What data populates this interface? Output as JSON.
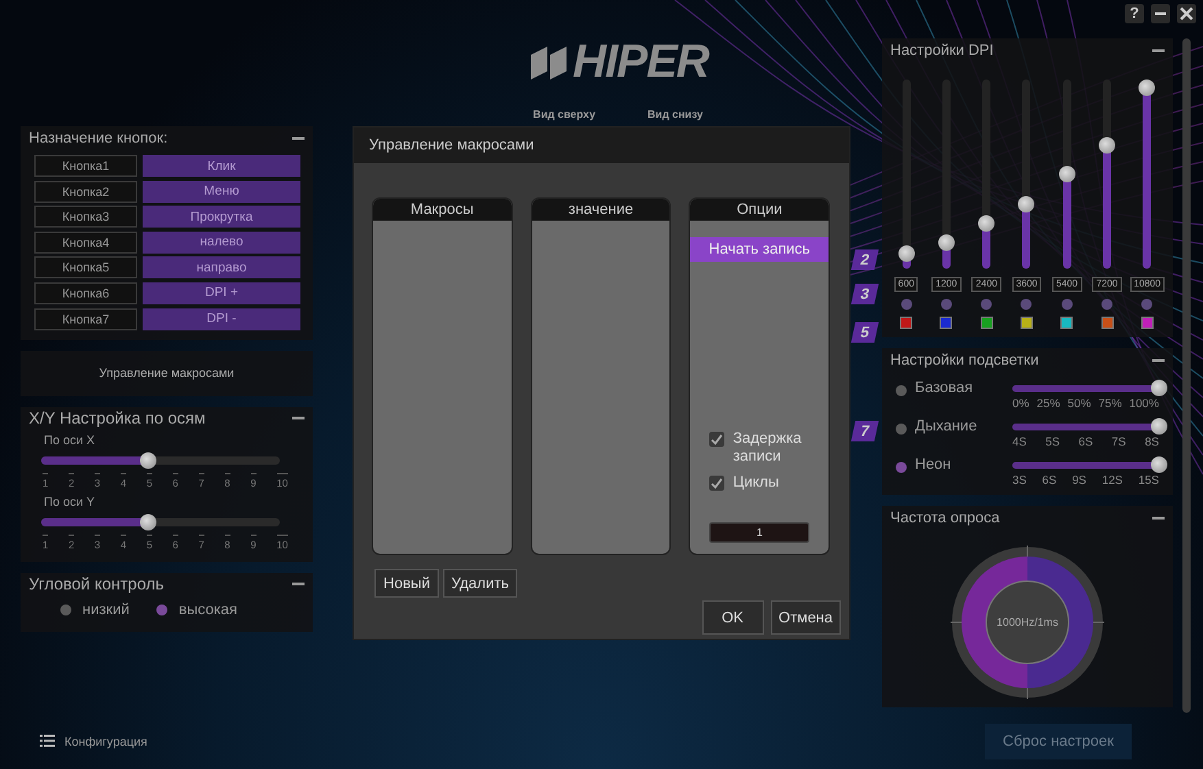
{
  "window_controls": {
    "help": "?"
  },
  "logo": {
    "text": "HIPER"
  },
  "views": [
    {
      "label": "Вид сверху"
    },
    {
      "label": "Вид снизу"
    }
  ],
  "button_assignment": {
    "title": "Назначение кнопок:",
    "rows": [
      {
        "button": "Кнопка1",
        "action": "Клик"
      },
      {
        "button": "Кнопка2",
        "action": "Меню"
      },
      {
        "button": "Кнопка3",
        "action": "Прокрутка"
      },
      {
        "button": "Кнопка4",
        "action": "налево"
      },
      {
        "button": "Кнопка5",
        "action": "направо"
      },
      {
        "button": "Кнопка6",
        "action": "DPI +"
      },
      {
        "button": "Кнопка7",
        "action": "DPI -"
      }
    ]
  },
  "macro_panel": {
    "label": "Управление макросами"
  },
  "axis": {
    "title": "X/Y Настройка по осям",
    "sliders": [
      {
        "label": "По оси X",
        "level": 0.45,
        "ticks": [
          "1",
          "2",
          "3",
          "4",
          "5",
          "6",
          "7",
          "8",
          "9",
          "10"
        ]
      },
      {
        "label": "По оси Y",
        "level": 0.45,
        "ticks": [
          "1",
          "2",
          "3",
          "4",
          "5",
          "6",
          "7",
          "8",
          "9",
          "10"
        ]
      }
    ]
  },
  "angle": {
    "title": "Угловой контроль",
    "options": [
      {
        "label": "низкий",
        "selected": false
      },
      {
        "label": "высокая",
        "selected": true
      }
    ]
  },
  "config": {
    "label": "Конфигурация"
  },
  "reset_button": "Сброс настроек",
  "profiles": [
    {
      "label": "2"
    },
    {
      "label": "3"
    },
    {
      "label": "5"
    },
    {
      "label": "7"
    }
  ],
  "dpi": {
    "title": "Настройки DPI",
    "levels": [
      {
        "value": "600",
        "level": 0.08,
        "color": "#c01818"
      },
      {
        "value": "1200",
        "level": 0.135,
        "color": "#1a2ad0"
      },
      {
        "value": "2400",
        "level": 0.24,
        "color": "#18a020"
      },
      {
        "value": "3600",
        "level": 0.34,
        "color": "#b8b018"
      },
      {
        "value": "5400",
        "level": 0.5,
        "color": "#18b8c0"
      },
      {
        "value": "7200",
        "level": 0.65,
        "color": "#c85018"
      },
      {
        "value": "10800",
        "level": 0.96,
        "color": "#c020b8"
      }
    ]
  },
  "lighting": {
    "title": "Настройки подсветки",
    "modes": [
      {
        "label": "Базовая",
        "selected": false,
        "level": 1,
        "ticks": [
          "0%",
          "25%",
          "50%",
          "75%",
          "100%"
        ]
      },
      {
        "label": "Дыхание",
        "selected": false,
        "level": 1,
        "ticks": [
          "4S",
          "5S",
          "6S",
          "7S",
          "8S"
        ]
      },
      {
        "label": "Неон",
        "selected": true,
        "level": 1,
        "ticks": [
          "3S",
          "6S",
          "9S",
          "12S",
          "15S"
        ]
      }
    ]
  },
  "polling": {
    "title": "Частота опроса",
    "value": "1000Hz/1ms"
  },
  "dialog": {
    "title": "Управление макросами",
    "columns": [
      {
        "kind": "list",
        "title": "Макросы"
      },
      {
        "kind": "list",
        "title": "значение"
      },
      {
        "kind": "options",
        "title": "Опции"
      }
    ],
    "record_button": "Начать запись",
    "options": [
      {
        "label": "Задержка записи",
        "checked": true
      },
      {
        "label": "Циклы",
        "checked": true
      }
    ],
    "loop_count": "1",
    "list_buttons": [
      "Новый",
      "Удалить"
    ],
    "buttons": [
      "OK",
      "Отмена"
    ]
  }
}
